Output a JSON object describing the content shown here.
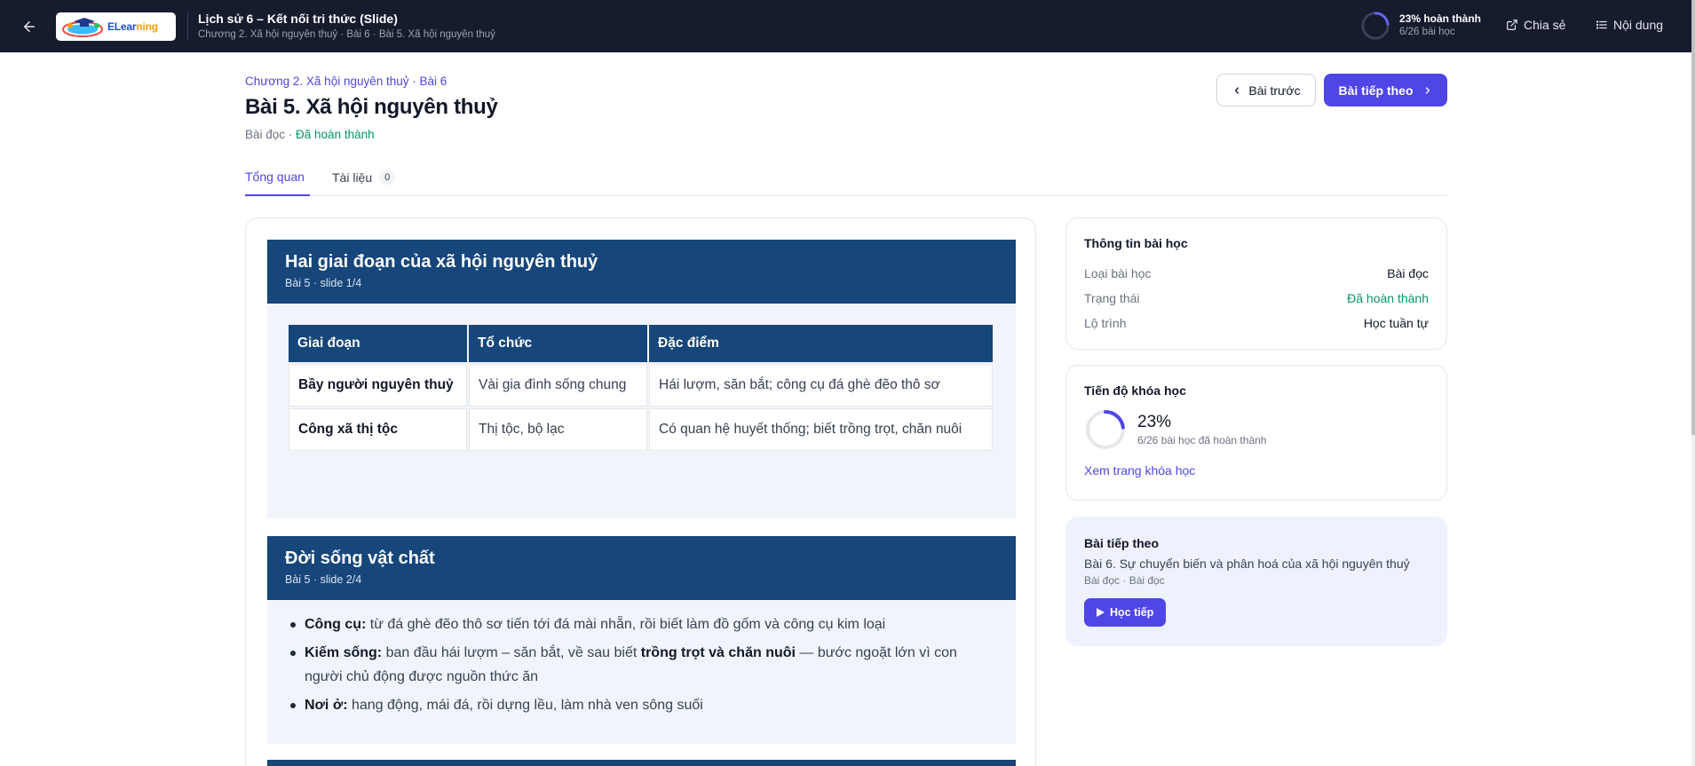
{
  "topbar": {
    "logo_text_1": "ELear",
    "logo_text_2": "ning",
    "course_title": "Lịch sử 6 – Kết nối tri thức (Slide)",
    "course_path": "Chương 2. Xã hội nguyên thuỷ · Bài 6 · Bài 5. Xã hội nguyên thuỷ",
    "progress_label": "23% hoàn thành",
    "progress_count": "6/26 bài học",
    "progress_fraction": 0.23,
    "share_label": "Chia sẻ",
    "content_label": "Nội dung"
  },
  "lesson": {
    "breadcrumb": "Chương 2. Xã hội nguyên thuỷ · Bài 6",
    "title": "Bài 5. Xã hội nguyên thuỷ",
    "type": "Bài đọc",
    "separator": " · ",
    "status": "Đã hoàn thành",
    "prev_label": "Bài trước",
    "next_label": "Bài tiếp theo"
  },
  "tabs": {
    "overview": "Tổng quan",
    "docs": "Tài liệu",
    "docs_count": "0"
  },
  "slides": [
    {
      "title": "Hai giai đoạn của xã hội nguyên thuỷ",
      "subtitle": "Bài 5 · slide 1/4",
      "headers": [
        "Giai đoạn",
        "Tổ chức",
        "Đặc điểm"
      ],
      "rows": [
        [
          "Bầy người nguyên thuỷ",
          "Vài gia đình sống chung",
          "Hái lượm, săn bắt; công cụ đá ghè đẽo thô sơ"
        ],
        [
          "Công xã thị tộc",
          "Thị tộc, bộ lạc",
          "Có quan hệ huyết thống; biết trồng trọt, chăn nuôi"
        ]
      ]
    },
    {
      "title": "Đời sống vật chất",
      "subtitle": "Bài 5 · slide 2/4",
      "facts": [
        {
          "label": "Công cụ:",
          "text": " từ đá ghè đẽo thô sơ tiến tới đá mài nhẵn, rồi biết làm đồ gốm và công cụ kim loại"
        },
        {
          "label": "Kiếm sống:",
          "text": " ban đầu hái lượm – săn bắt, về sau biết ",
          "bold": "trồng trọt và chăn nuôi",
          "tail": " — bước ngoặt lớn vì con người chủ động được nguồn thức ăn"
        },
        {
          "label": "Nơi ở:",
          "text": " hang động, mái đá, rồi dựng lều, làm nhà ven sông suối"
        }
      ]
    }
  ],
  "sidebar": {
    "info": {
      "heading": "Thông tin bài học",
      "rows": [
        {
          "key": "Loại bài học",
          "value": "Bài đọc"
        },
        {
          "key": "Trạng thái",
          "value": "Đã hoàn thành"
        },
        {
          "key": "Lộ trình",
          "value": "Học tuần tự"
        }
      ]
    },
    "progress": {
      "heading": "Tiến độ khóa học",
      "percent": "23%",
      "fraction": 0.23,
      "count": "6/26 bài học đã hoàn thành",
      "link": "Xem trang khóa học"
    },
    "next": {
      "heading": "Bài tiếp theo",
      "title": "Bài 6. Sự chuyển biến và phân hoá của xã hội nguyên thuỷ",
      "meta": "Bài đọc · Bài đọc",
      "button": "Học tiếp"
    }
  },
  "colors": {
    "topbar": "#171b2e",
    "accent": "#4f46e5",
    "slide_header": "#16467a",
    "success": "#059669"
  }
}
